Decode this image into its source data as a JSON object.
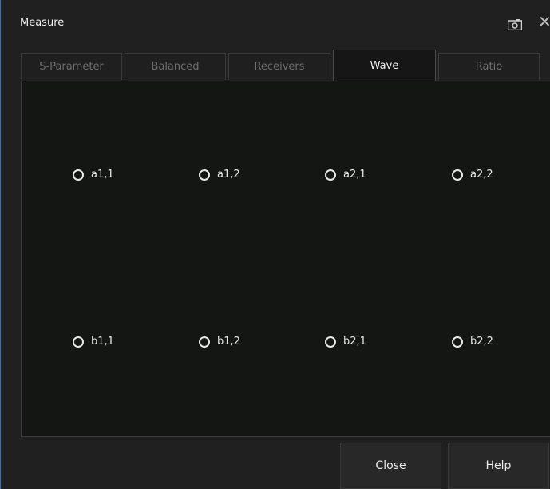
{
  "window": {
    "title": "Measure"
  },
  "tabs": [
    {
      "label": "S-Parameter",
      "active": false
    },
    {
      "label": "Balanced",
      "active": false
    },
    {
      "label": "Receivers",
      "active": false
    },
    {
      "label": "Wave",
      "active": true
    },
    {
      "label": "Ratio",
      "active": false
    }
  ],
  "options": {
    "row_a": [
      "a1,1",
      "a1,2",
      "a2,1",
      "a2,2"
    ],
    "row_b": [
      "b1,1",
      "b1,2",
      "b2,1",
      "b2,2"
    ]
  },
  "buttons": {
    "close": "Close",
    "help": "Help"
  },
  "icons": {
    "snapshot": "camera-icon",
    "close": "close-icon"
  }
}
